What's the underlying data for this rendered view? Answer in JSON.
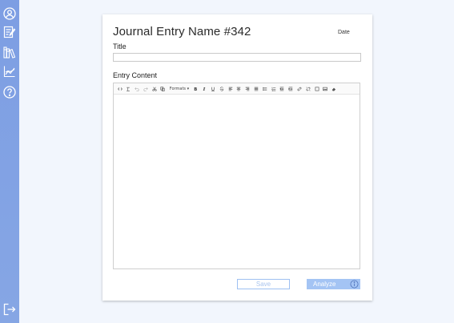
{
  "sidebar": {
    "items": [
      {
        "icon": "user-circle-icon"
      },
      {
        "icon": "edit-note-icon"
      },
      {
        "icon": "library-icon"
      },
      {
        "icon": "analytics-chart-icon"
      },
      {
        "icon": "help-icon"
      }
    ],
    "logout_icon": "logout-icon"
  },
  "entry": {
    "name": "Journal Entry Name #342",
    "date_label": "Date",
    "title_label": "Title",
    "title_value": "",
    "content_label": "Entry Content",
    "content_value": ""
  },
  "toolbar": {
    "formats_label": "Formats ▾",
    "buttons": [
      "source-code-icon",
      "clear-format-icon",
      "undo-icon",
      "redo-icon",
      "cut-icon",
      "copy-icon",
      "formats-dropdown",
      "bold-icon",
      "italic-icon",
      "underline-icon",
      "strikethrough-icon",
      "align-left-icon",
      "align-center-icon",
      "align-right-icon",
      "align-justify-icon",
      "bullet-list-icon",
      "numbered-list-icon",
      "outdent-icon",
      "indent-icon",
      "link-icon",
      "unlink-icon",
      "blockquote-icon",
      "image-icon",
      "eraser-icon"
    ]
  },
  "actions": {
    "save_label": "Save",
    "analyze_label": "Analyze",
    "analyze_info_icon": "info-icon"
  },
  "colors": {
    "sidebar": "#7d9ee3",
    "background": "#f2f6fd",
    "button_primary": "#a4c4f4",
    "button_outline": "#9ec0f2"
  }
}
